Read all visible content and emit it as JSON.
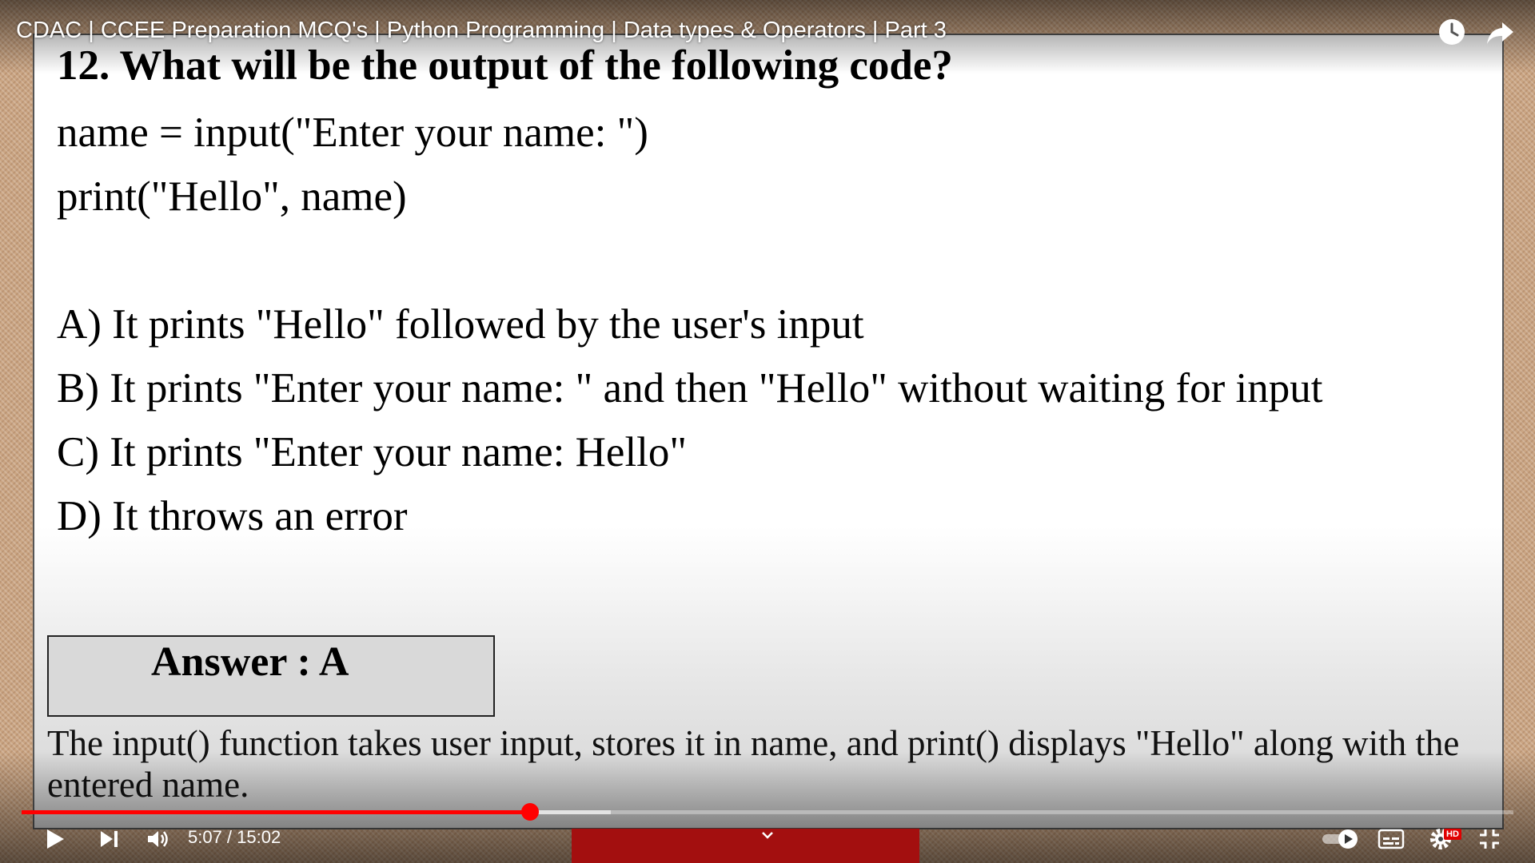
{
  "video": {
    "title": "CDAC | CCEE Preparation MCQ's | Python Programming | Data types & Operators | Part 3",
    "time_display": "5:07 / 15:02",
    "progress_fraction": 0.341,
    "buffered_fraction": 0.395,
    "hd_label": "HD",
    "accent_color": "#ff0000"
  },
  "slide": {
    "question_title": "12. What will be the output of  the following code?",
    "code": [
      "name = input(\"Enter your name: \")",
      "print(\"Hello\", name)"
    ],
    "options": [
      "A) It prints \"Hello\" followed by the user's input",
      "B) It prints \"Enter your name: \" and then \"Hello\" without waiting for input",
      "C) It prints \"Enter your name: Hello\"",
      "D) It throws an error"
    ],
    "answer": "Answer : A",
    "explanation": "The input() function takes user input, stores it in name, and print() displays \"Hello\" along with the entered name."
  },
  "icons": {
    "watch_later": "clock-icon",
    "share": "share-arrow-icon",
    "play": "play-icon",
    "next": "next-icon",
    "volume": "volume-icon",
    "autoplay": "autoplay-toggle-icon",
    "captions": "subtitles-icon",
    "settings": "gear-icon",
    "fullscreen_exit": "exit-fullscreen-icon"
  }
}
